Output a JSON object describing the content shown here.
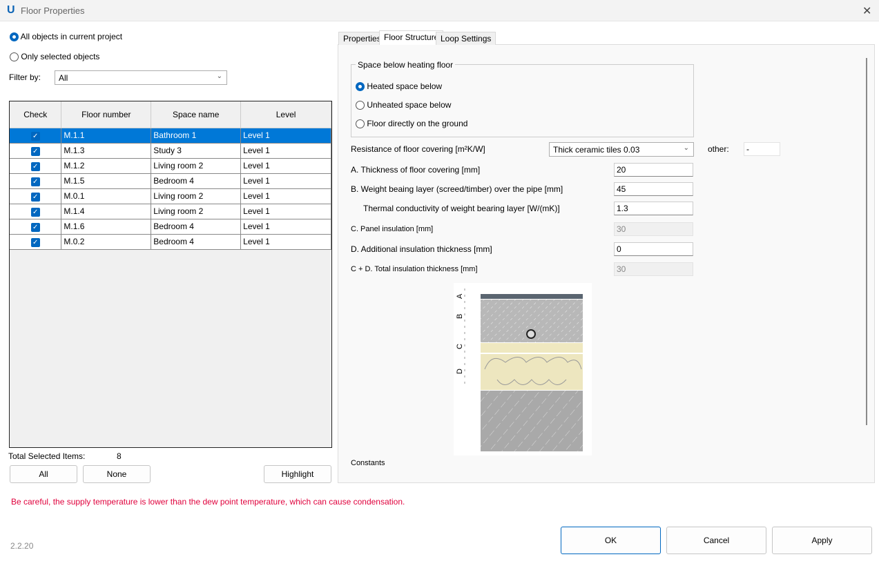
{
  "window": {
    "title": "Floor Properties",
    "logo": "U"
  },
  "scope": {
    "options": [
      "All objects in current project",
      "Only selected objects"
    ],
    "selected": 0
  },
  "filter": {
    "label": "Filter by:",
    "value": "All"
  },
  "table": {
    "columns": [
      "Check",
      "Floor number",
      "Space name",
      "Level"
    ],
    "rows": [
      {
        "checked": true,
        "floor": "M.1.1",
        "space": "Bathroom 1",
        "level": "Level 1",
        "selected": true
      },
      {
        "checked": true,
        "floor": "M.1.3",
        "space": "Study 3",
        "level": "Level 1"
      },
      {
        "checked": true,
        "floor": "M.1.2",
        "space": "Living room 2",
        "level": "Level 1"
      },
      {
        "checked": true,
        "floor": "M.1.5",
        "space": "Bedroom 4",
        "level": "Level 1"
      },
      {
        "checked": true,
        "floor": "M.0.1",
        "space": "Living room 2",
        "level": "Level 1"
      },
      {
        "checked": true,
        "floor": "M.1.4",
        "space": "Living room 2",
        "level": "Level 1"
      },
      {
        "checked": true,
        "floor": "M.1.6",
        "space": "Bedroom 4",
        "level": "Level 1"
      },
      {
        "checked": true,
        "floor": "M.0.2",
        "space": "Bedroom 4",
        "level": "Level 1"
      }
    ]
  },
  "totals": {
    "label": "Total Selected Items:",
    "value": "8"
  },
  "buttons": {
    "all": "All",
    "none": "None",
    "highlight": "Highlight",
    "ok": "OK",
    "cancel": "Cancel",
    "apply": "Apply"
  },
  "tabs": [
    "Properties",
    "Floor Structure",
    "Loop Settings"
  ],
  "active_tab": 1,
  "structure": {
    "group_title": "Space below heating floor",
    "space_options": [
      "Heated space below",
      "Unheated space below",
      "Floor directly on the ground"
    ],
    "space_selected": 0,
    "resistance_label": "Resistance of floor covering [m²K/W]",
    "resistance_value": "Thick ceramic tiles 0.03",
    "other_label": "other:",
    "other_value": "-",
    "fields": [
      {
        "label": "A. Thickness of floor covering [mm]",
        "value": "20",
        "disabled": false
      },
      {
        "label": "B. Weight beaing layer (screed/timber) over the pipe [mm]",
        "value": "45",
        "disabled": false
      },
      {
        "label": "Thermal conductivity of weight bearing layer [W/(mK)]",
        "value": "1.3",
        "disabled": false
      },
      {
        "label": "C. Panel insulation [mm]",
        "value": "30",
        "disabled": true
      },
      {
        "label": "D. Additional insulation thickness [mm]",
        "value": "0",
        "disabled": false
      },
      {
        "label": "C + D. Total insulation thickness [mm]",
        "value": "30",
        "disabled": true
      }
    ],
    "diagram_labels": [
      "A",
      "B",
      "C",
      "D"
    ],
    "constants_label": "Constants"
  },
  "warning": {
    "text": "Be careful, the supply temperature is lower than the dew point temperature, which can cause condensation.",
    "color": "#e0003c"
  },
  "version": "2.2.20",
  "colors": {
    "accent": "#0067c0",
    "selection": "#0078d7"
  }
}
